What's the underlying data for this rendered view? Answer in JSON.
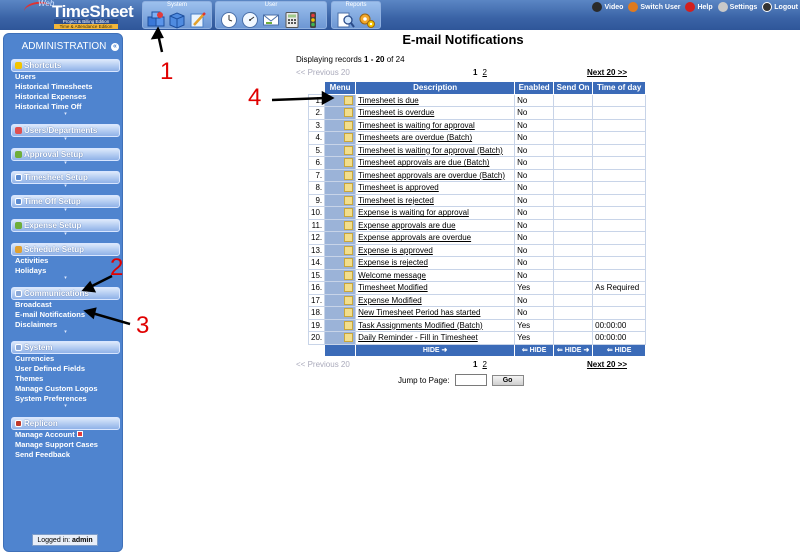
{
  "logo": {
    "web": "Web",
    "name": "TimeSheet",
    "edition1": "Project & Billing Edition",
    "edition2": "Time & Attendance Edition"
  },
  "nav_groups": [
    {
      "title": "System",
      "icons": [
        "cubes-icon",
        "box-icon",
        "pencil-icon"
      ]
    },
    {
      "title": "User",
      "icons": [
        "clock-icon",
        "clock-alt-icon",
        "envelope-icon",
        "calculator-icon",
        "traffic-light-icon"
      ]
    },
    {
      "title": "Reports",
      "icons": [
        "magnifier-icon",
        "gears-icon"
      ]
    }
  ],
  "toplinks": [
    {
      "label": "Video",
      "icon": "video-icon",
      "color": "#2a2a2a"
    },
    {
      "label": "Switch User",
      "icon": "switch-user-icon",
      "color": "#e07a1f"
    },
    {
      "label": "Help",
      "icon": "help-icon",
      "color": "#d21f1f"
    },
    {
      "label": "Settings",
      "icon": "settings-icon",
      "color": "#c9c9c9"
    },
    {
      "label": "Logout",
      "icon": "logout-icon",
      "color": "#333333"
    }
  ],
  "sidebar": {
    "title": "ADMINISTRATION",
    "sections": [
      {
        "title": "Shortcuts",
        "icon": "star-icon",
        "color": "#f2c400",
        "items": [
          "Users",
          "Historical Timesheets",
          "Historical Expenses",
          "Historical Time Off"
        ]
      },
      {
        "title": "Users/Departments",
        "icon": "users-icon",
        "color": "#e05050",
        "items": []
      },
      {
        "title": "Approval Setup",
        "icon": "approval-icon",
        "color": "#6fae3a",
        "items": []
      },
      {
        "title": "Timesheet Setup",
        "icon": "timesheet-icon",
        "color": "#5a8ad0",
        "items": []
      },
      {
        "title": "Time Off Setup",
        "icon": "timeoff-icon",
        "color": "#5a8ad0",
        "items": []
      },
      {
        "title": "Expense Setup",
        "icon": "expense-icon",
        "color": "#6fae3a",
        "items": []
      },
      {
        "title": "Schedule Setup",
        "icon": "schedule-icon",
        "color": "#e0a030",
        "items": [
          "Activities",
          "Holidays"
        ]
      },
      {
        "title": "Communications",
        "icon": "communications-icon",
        "color": "#8aa8d8",
        "items": [
          "Broadcast",
          "E-mail Notifications",
          "Disclaimers"
        ]
      },
      {
        "title": "System",
        "icon": "system-icon",
        "color": "#8aa8d8",
        "items": [
          "Currencies",
          "User Defined Fields",
          "Themes",
          "Manage Custom Logos",
          "System Preferences"
        ]
      },
      {
        "title": "Replicon",
        "icon": "replicon-icon",
        "color": "#c0392b",
        "items": [
          "Manage Account",
          "Manage Support Cases",
          "Send Feedback"
        ]
      }
    ],
    "logged_label": "Logged in:",
    "logged_user": "admin"
  },
  "main": {
    "title": "E-mail Notifications",
    "displaying_prefix": "Displaying records ",
    "displaying_range": "1 - 20",
    "displaying_suffix": " of 24",
    "pager": {
      "prev": "<< Previous 20",
      "current": "1",
      "other": "2",
      "next": "Next 20 >>"
    },
    "columns": [
      "Menu",
      "Description",
      "Enabled",
      "Send On",
      "Time of day"
    ],
    "rows": [
      {
        "n": "1.",
        "desc": "Timesheet is due",
        "enabled": "No",
        "send_on": "",
        "tod": ""
      },
      {
        "n": "2.",
        "desc": "Timesheet is overdue",
        "enabled": "No",
        "send_on": "",
        "tod": ""
      },
      {
        "n": "3.",
        "desc": "Timesheet is waiting for approval",
        "enabled": "No",
        "send_on": "",
        "tod": ""
      },
      {
        "n": "4.",
        "desc": "Timesheets are overdue (Batch)",
        "enabled": "No",
        "send_on": "",
        "tod": ""
      },
      {
        "n": "5.",
        "desc": "Timesheet is waiting for approval (Batch)",
        "enabled": "No",
        "send_on": "",
        "tod": ""
      },
      {
        "n": "6.",
        "desc": "Timesheet approvals are due (Batch)",
        "enabled": "No",
        "send_on": "",
        "tod": ""
      },
      {
        "n": "7.",
        "desc": "Timesheet approvals are overdue (Batch)",
        "enabled": "No",
        "send_on": "",
        "tod": ""
      },
      {
        "n": "8.",
        "desc": "Timesheet is approved",
        "enabled": "No",
        "send_on": "",
        "tod": ""
      },
      {
        "n": "9.",
        "desc": "Timesheet is rejected",
        "enabled": "No",
        "send_on": "",
        "tod": ""
      },
      {
        "n": "10.",
        "desc": "Expense is waiting for approval",
        "enabled": "No",
        "send_on": "",
        "tod": ""
      },
      {
        "n": "11.",
        "desc": "Expense approvals are due",
        "enabled": "No",
        "send_on": "",
        "tod": ""
      },
      {
        "n": "12.",
        "desc": "Expense approvals are overdue",
        "enabled": "No",
        "send_on": "",
        "tod": ""
      },
      {
        "n": "13.",
        "desc": "Expense is approved",
        "enabled": "No",
        "send_on": "",
        "tod": ""
      },
      {
        "n": "14.",
        "desc": "Expense is rejected",
        "enabled": "No",
        "send_on": "",
        "tod": ""
      },
      {
        "n": "15.",
        "desc": "Welcome message",
        "enabled": "No",
        "send_on": "",
        "tod": ""
      },
      {
        "n": "16.",
        "desc": "Timesheet Modified",
        "enabled": "Yes",
        "send_on": "",
        "tod": "As Required"
      },
      {
        "n": "17.",
        "desc": "Expense Modified",
        "enabled": "No",
        "send_on": "",
        "tod": ""
      },
      {
        "n": "18.",
        "desc": "New Timesheet Period has started",
        "enabled": "No",
        "send_on": "",
        "tod": ""
      },
      {
        "n": "19.",
        "desc": "Task Assignments Modified (Batch)",
        "enabled": "Yes",
        "send_on": "",
        "tod": "00:00:00"
      },
      {
        "n": "20.",
        "desc": "Daily Reminder - Fill in Timesheet",
        "enabled": "Yes",
        "send_on": "",
        "tod": "00:00:00"
      }
    ],
    "hide_label": "HIDE",
    "jump_label": "Jump to Page:",
    "jump_value": "",
    "go_label": "Go"
  },
  "annotations": [
    "1",
    "2",
    "3",
    "4"
  ],
  "colors": {
    "accent": "#3b6bb8",
    "sidebar": "#4f84cf",
    "annotation": "#e00000"
  }
}
